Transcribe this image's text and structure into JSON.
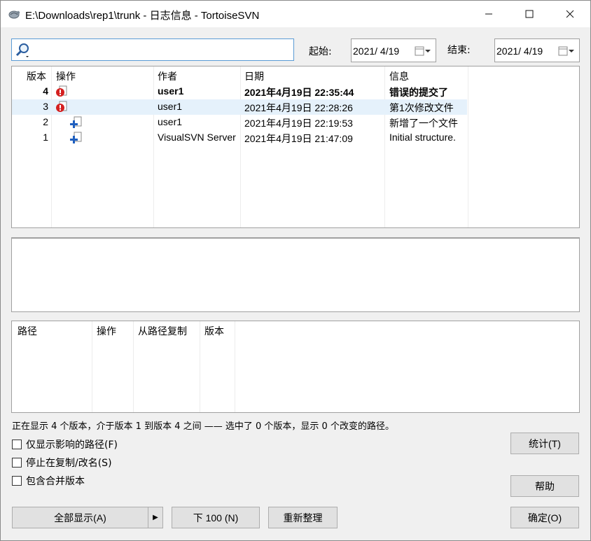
{
  "window": {
    "title": "E:\\Downloads\\rep1\\trunk - 日志信息 - TortoiseSVN",
    "minimize": "—",
    "maximize": "☐",
    "close": "✕"
  },
  "filter": {
    "search_value": "",
    "from_label": "起始:",
    "from_date": "2021/  4/19",
    "to_label": "结束:",
    "to_date": "2021/  4/19"
  },
  "log": {
    "columns": [
      "版本",
      "操作",
      "作者",
      "日期",
      "信息"
    ],
    "rows": [
      {
        "rev": "4",
        "action_icon": "conflict-icon",
        "author": "user1",
        "date": "2021年4月19日 22:35:44",
        "message": "错误的提交了",
        "bold": true,
        "selected": false
      },
      {
        "rev": "3",
        "action_icon": "conflict-icon",
        "author": "user1",
        "date": "2021年4月19日 22:28:26",
        "message": "第1次修改文件",
        "bold": false,
        "selected": true
      },
      {
        "rev": "2",
        "action_icon": "add-file-icon",
        "author": "user1",
        "date": "2021年4月19日 22:19:53",
        "message": "新增了一个文件",
        "bold": false,
        "selected": false
      },
      {
        "rev": "1",
        "action_icon": "add-file-icon",
        "author": "VisualSVN Server",
        "date": "2021年4月19日 21:47:09",
        "message": "Initial structure.",
        "bold": false,
        "selected": false
      }
    ]
  },
  "paths": {
    "columns": [
      "路径",
      "操作",
      "从路径复制",
      "版本"
    ]
  },
  "status_text": "正在显示 4 个版本，介于版本 1 到版本 4 之间 —— 选中了 0 个版本，显示 0 个改变的路径。",
  "options": {
    "affected_paths": "仅显示影响的路径(F)",
    "stop_on_copy": "停止在复制/改名(S)",
    "include_merged": "包含合并版本"
  },
  "buttons": {
    "show_all": "全部显示(A)",
    "split_arrow": "▶",
    "next_100": "下 100 (N)",
    "refresh": "重新整理",
    "statistics": "统计(T)",
    "help": "帮助",
    "ok": "确定(O)"
  },
  "colors": {
    "conflict": "#d42020",
    "add": "#1f5fbf",
    "selected_row": "#e5f1fb"
  }
}
